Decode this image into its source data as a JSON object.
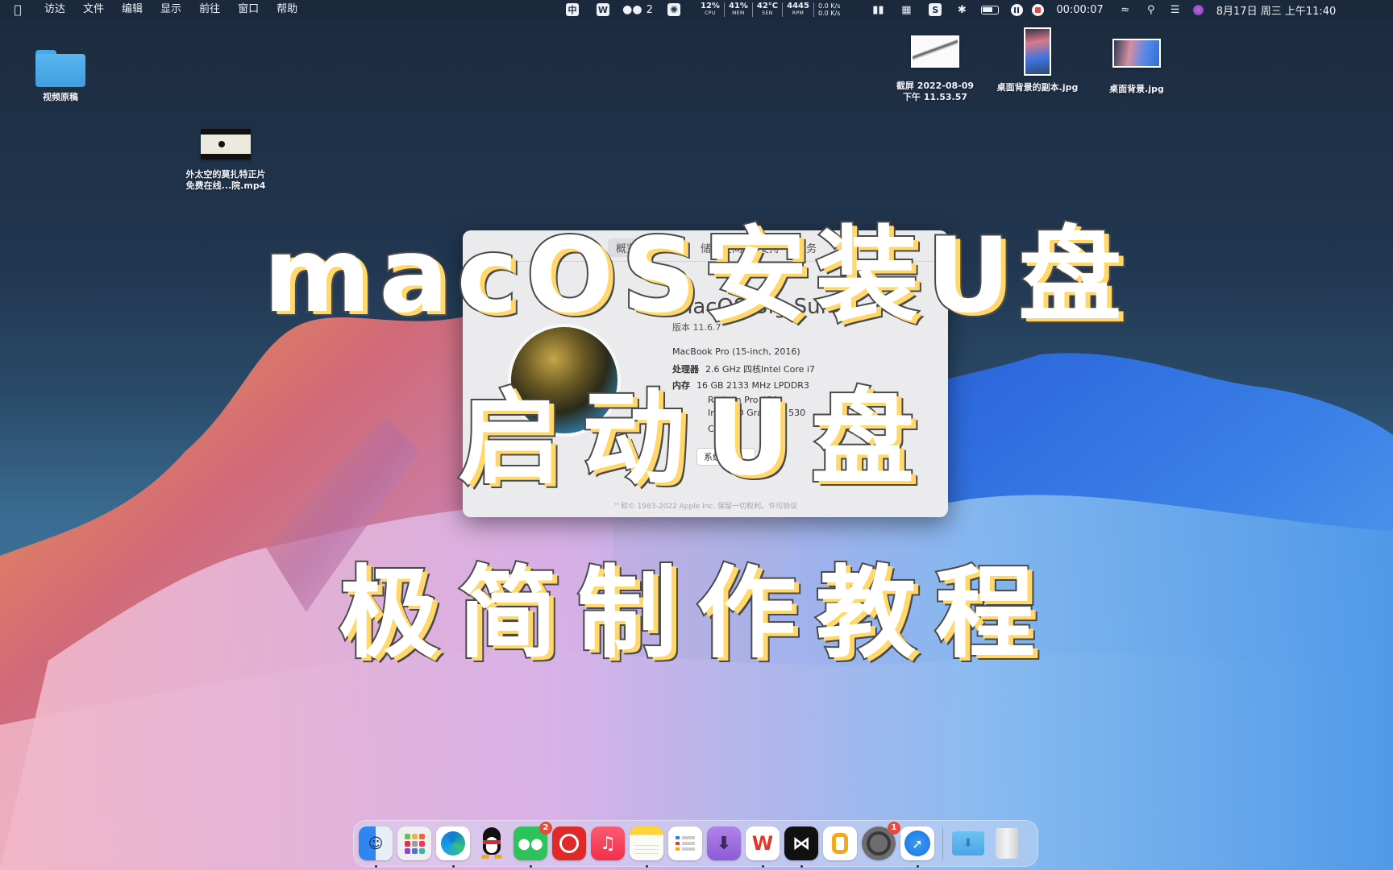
{
  "menubar": {
    "apple_icon": "apple-logo-icon",
    "items": [
      "访达",
      "文件",
      "编辑",
      "显示",
      "前往",
      "窗口",
      "帮助"
    ],
    "tray": {
      "input_method": "中",
      "wps_icon": "W",
      "wechat_count": "2",
      "stats": [
        {
          "value": "12%",
          "label": "CPU"
        },
        {
          "value": "41%",
          "label": "MEM"
        },
        {
          "value": "42°C",
          "label": "SEN"
        },
        {
          "value": "4445",
          "label": "RPM"
        }
      ],
      "net_up": "0.0 K/s",
      "net_down": "0.0 K/s",
      "recording_time": "00:00:07",
      "datetime": "8月17日 周三 上午11:40"
    }
  },
  "desktop": {
    "icons": [
      {
        "name": "视频原稿",
        "type": "folder"
      },
      {
        "name_line1": "外太空的莫扎特正片",
        "name_line2": "免费在线...院.mp4",
        "type": "video"
      },
      {
        "name_line1": "截屏 2022-08-09",
        "name_line2": "下午 11.53.57",
        "type": "screenshot"
      },
      {
        "name": "桌面背景的副本.jpg",
        "type": "image"
      },
      {
        "name": "桌面背景.jpg",
        "type": "image"
      }
    ]
  },
  "about_window": {
    "tabs": [
      "概览",
      "显示器",
      "储存空间",
      "支持",
      "服务"
    ],
    "os_name": "macOS Big Sur",
    "version": "版本 11.6.7",
    "model": "MacBook Pro (15-inch, 2016)",
    "processor_label": "处理器",
    "processor": "2.6 GHz 四核Intel Core i7",
    "memory_label": "内存",
    "memory": "16 GB 2133 MHz LPDDR3",
    "graphics1": "Radeon Pro 450",
    "graphics2": "Intel HD Graphics 530",
    "serial": "C02…",
    "report_button": "系统报告...",
    "copyright": "™和© 1983-2022 Apple Inc. 保留一切权利。许可协议"
  },
  "overlay_title": {
    "line1": "macOS安装U盘",
    "line2": "启动U盘",
    "line3": "极简制作教程",
    "fill_color": "#ffffff",
    "shadow_color": "#ffd76a",
    "stroke_color": "#4a4a4a"
  },
  "dock": {
    "apps": [
      {
        "name": "访达",
        "icon": "finder-icon",
        "running": true,
        "badge": null,
        "color": "#3d8ef0"
      },
      {
        "name": "启动台",
        "icon": "launchpad-icon",
        "running": false,
        "badge": null,
        "color": "#eeeeee"
      },
      {
        "name": "Microsoft Edge",
        "icon": "edge-icon",
        "running": true,
        "badge": null,
        "color": "#ffffff"
      },
      {
        "name": "QQ",
        "icon": "qq-penguin-icon",
        "running": false,
        "badge": null,
        "color": "transparent"
      },
      {
        "name": "微信",
        "icon": "wechat-icon",
        "running": true,
        "badge": "2",
        "color": "#2dc35a"
      },
      {
        "name": "网易云音乐",
        "icon": "netease-music-icon",
        "running": false,
        "badge": null,
        "color": "#e02a2a"
      },
      {
        "name": "音乐",
        "icon": "music-icon",
        "running": false,
        "badge": null,
        "color": "#f4364c"
      },
      {
        "name": "备忘录",
        "icon": "notes-icon",
        "running": true,
        "badge": null,
        "color": "#fbfbf5"
      },
      {
        "name": "提醒事项",
        "icon": "reminders-icon",
        "running": false,
        "badge": null,
        "color": "#ffffff"
      },
      {
        "name": "下载器",
        "icon": "downloader-icon",
        "running": false,
        "badge": null,
        "color": "#a070e0"
      },
      {
        "name": "WPS Office",
        "icon": "wps-icon",
        "running": true,
        "badge": null,
        "color": "#ffffff"
      },
      {
        "name": "剪映",
        "icon": "capcut-icon",
        "running": true,
        "badge": null,
        "color": "#111111"
      },
      {
        "name": "Office",
        "icon": "office-hex-icon",
        "running": false,
        "badge": null,
        "color": "#ffffff"
      },
      {
        "name": "系统偏好设置",
        "icon": "system-preferences-icon",
        "running": false,
        "badge": "1",
        "color": "#6d6d70"
      },
      {
        "name": "Safari浏览器",
        "icon": "safari-icon",
        "running": true,
        "badge": null,
        "color": "#ffffff"
      }
    ],
    "downloads_icon": "downloads-folder-icon",
    "trash_icon": "trash-icon"
  }
}
